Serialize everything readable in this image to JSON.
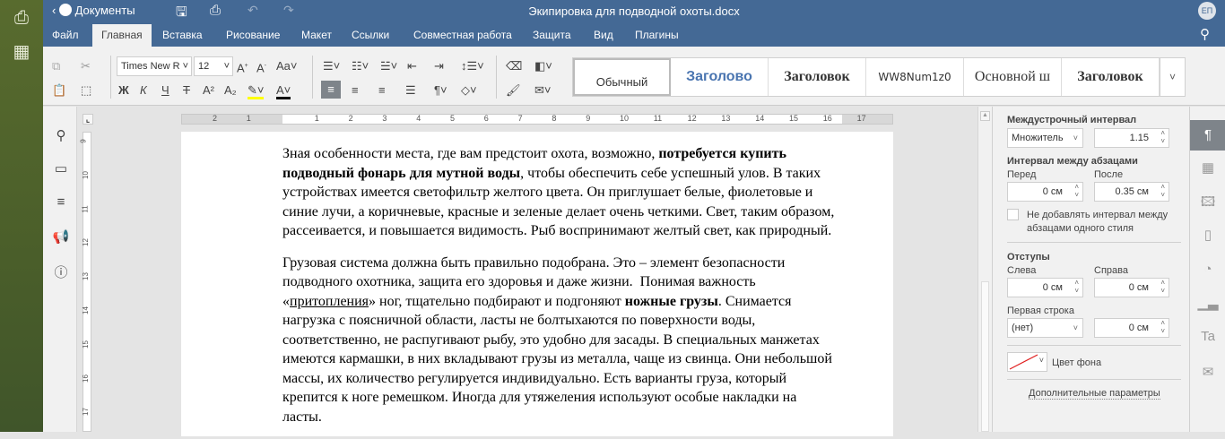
{
  "header": {
    "back_label": "Документы",
    "doc_title": "Экипировка для подводной охоты.docx",
    "user_initials": "ЕП"
  },
  "tabs": [
    "Файл",
    "Главная",
    "Вставка",
    "Рисование",
    "Макет",
    "Ссылки",
    "Совместная работа",
    "Защита",
    "Вид",
    "Плагины"
  ],
  "active_tab": "Главная",
  "toolbar": {
    "font_name": "Times New R",
    "font_size": "12",
    "bold": "Ж",
    "italic": "К",
    "underline": "Ч",
    "strike": "Т",
    "superscript": "A²",
    "subscript": "A₂",
    "highlight_color": "#ffff00",
    "font_color": "#000000"
  },
  "styles": [
    "Обычный",
    "Заголово",
    "Заголовок",
    "WW8Num1z0",
    "Основной ш",
    "Заголовок"
  ],
  "ruler": {
    "h_labels": [
      "2",
      "1",
      "1",
      "2",
      "3",
      "4",
      "5",
      "6",
      "7",
      "8",
      "9",
      "10",
      "11",
      "12",
      "13",
      "14",
      "15",
      "16",
      "17"
    ],
    "v_labels": [
      "9",
      "10",
      "11",
      "12",
      "13",
      "14",
      "15",
      "16",
      "17"
    ]
  },
  "document": {
    "paragraphs": [
      [
        [
          {
            "t": "Зная особенности места, где вам предстоит охота, возможно, "
          },
          {
            "t": "потребуется купить",
            "b": true
          }
        ],
        [
          {
            "t": "подводный фонарь для мутной воды",
            "b": true
          },
          {
            "t": ", чтобы обеспечить себе успешный улов. В таких"
          }
        ],
        [
          {
            "t": "устройствах имеется светофильтр желтого цвета. Он приглушает белые, фиолетовые и"
          }
        ],
        [
          {
            "t": "синие лучи, а коричневые, красные и зеленые делает очень четкими. Свет, таким образом,"
          }
        ],
        [
          {
            "t": "рассеивается, и повышается видимость. Рыб воспринимают желтый свет, как природный."
          }
        ]
      ],
      [
        [
          {
            "t": "Грузовая система должна быть правильно подобрана. Это – элемент безопасности"
          }
        ],
        [
          {
            "t": "подводного охотника, защита его здоровья и даже жизни.  Понимая важность"
          }
        ],
        [
          {
            "t": "«"
          },
          {
            "t": "притопления",
            "u": true
          },
          {
            "t": "» ног, тщательно подбирают и подгоняют "
          },
          {
            "t": "ножные грузы",
            "b": true
          },
          {
            "t": ". Снимается"
          }
        ],
        [
          {
            "t": "нагрузка с поясничной области, ласты не болтыхаются по поверхности воды,"
          }
        ],
        [
          {
            "t": "соответственно, не распугивают рыбу, это удобно для засады. В специальных манжетах"
          }
        ],
        [
          {
            "t": "имеются кармашки, в них вкладывают грузы из металла, чаще из свинца. Они небольшой"
          }
        ],
        [
          {
            "t": "массы, их количество регулируется индивидуально. Есть варианты груза, который"
          }
        ],
        [
          {
            "t": "крепится к ноге ремешком. Иногда для утяжеления используют особые накладки на"
          }
        ],
        [
          {
            "t": "ласты."
          }
        ]
      ]
    ]
  },
  "panel": {
    "line_spacing_title": "Междустрочный интервал",
    "line_spacing_type": "Множитель",
    "line_spacing_value": "1.15",
    "para_spacing_title": "Интервал между абзацами",
    "before_label": "Перед",
    "before_value": "0 см",
    "after_label": "После",
    "after_value": "0.35 см",
    "no_space_same_style": "Не добавлять интервал между абзацами одного стиля",
    "no_space_checked": false,
    "indents_title": "Отступы",
    "left_label": "Слева",
    "left_value": "0 см",
    "right_label": "Справа",
    "right_value": "0 см",
    "first_line_label": "Первая строка",
    "first_line_type": "(нет)",
    "first_line_value": "0 см",
    "bg_color_label": "Цвет фона",
    "advanced_link": "Дополнительные параметры"
  }
}
